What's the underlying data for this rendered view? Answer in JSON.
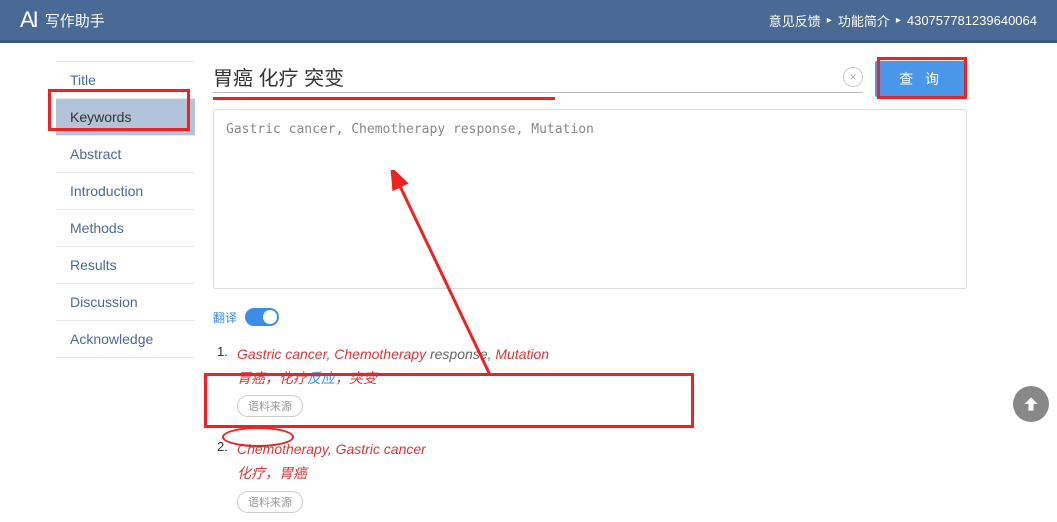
{
  "header": {
    "logo": "AI",
    "subtitle": "写作助手",
    "nav": {
      "feedback": "意见反馈",
      "features": "功能简介",
      "user_id": "430757781239640064"
    }
  },
  "sidebar": {
    "items": [
      {
        "label": "Title"
      },
      {
        "label": "Keywords"
      },
      {
        "label": "Abstract"
      },
      {
        "label": "Introduction"
      },
      {
        "label": "Methods"
      },
      {
        "label": "Results"
      },
      {
        "label": "Discussion"
      },
      {
        "label": "Acknowledge"
      }
    ],
    "active_index": 1
  },
  "main": {
    "search_value": "胃癌 化疗 突变",
    "clear_glyph": "×",
    "query_button": "查 询",
    "textarea_value": "Gastric cancer, Chemotherapy response, Mutation",
    "translate_label": "翻译",
    "toggle_on": true,
    "results": [
      {
        "num": "1.",
        "en_parts": [
          {
            "t": "Gastric cancer",
            "hl": true
          },
          {
            "t": ", ",
            "hl": false
          },
          {
            "t": "Chemotherapy",
            "hl": true
          },
          {
            "t": " response, ",
            "hl": false
          },
          {
            "t": "Mutation",
            "hl": true
          }
        ],
        "zh_parts": [
          {
            "t": "胃癌",
            "cls": "hl"
          },
          {
            "t": "，",
            "cls": "sep"
          },
          {
            "t": "化疗",
            "cls": "hl"
          },
          {
            "t": "反应",
            "cls": "nhl"
          },
          {
            "t": "，",
            "cls": "sep"
          },
          {
            "t": "突变",
            "cls": "hl"
          }
        ],
        "source_label": "语料来源"
      },
      {
        "num": "2.",
        "en_parts": [
          {
            "t": "Chemotherapy",
            "hl": true
          },
          {
            "t": ", ",
            "hl": false
          },
          {
            "t": "Gastric cancer",
            "hl": true
          }
        ],
        "zh_parts": [
          {
            "t": "化疗",
            "cls": "hl"
          },
          {
            "t": "，",
            "cls": "sep"
          },
          {
            "t": "胃癌",
            "cls": "hl"
          }
        ],
        "source_label": "语料来源"
      }
    ]
  }
}
